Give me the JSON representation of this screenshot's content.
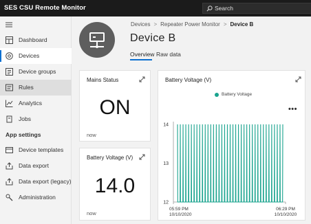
{
  "app": {
    "title": "SES CSU Remote Monitor",
    "search_placeholder": "Search"
  },
  "sidebar": {
    "items": [
      {
        "label": "Dashboard",
        "icon": "dashboard-icon"
      },
      {
        "label": "Devices",
        "icon": "devices-icon"
      },
      {
        "label": "Device groups",
        "icon": "device-groups-icon"
      },
      {
        "label": "Rules",
        "icon": "rules-icon"
      },
      {
        "label": "Analytics",
        "icon": "analytics-icon"
      },
      {
        "label": "Jobs",
        "icon": "jobs-icon"
      }
    ],
    "section_title": "App settings",
    "settings_items": [
      {
        "label": "Device templates",
        "icon": "device-templates-icon"
      },
      {
        "label": "Data export",
        "icon": "data-export-icon"
      },
      {
        "label": "Data export (legacy)",
        "icon": "data-export-legacy-icon"
      },
      {
        "label": "Administration",
        "icon": "administration-icon"
      }
    ],
    "active_item": "Devices",
    "hover_item": "Rules"
  },
  "breadcrumb": {
    "items": [
      "Devices",
      "Repeater Power Monitor",
      "Device B"
    ]
  },
  "device": {
    "name": "Device B",
    "icon": "device-icon"
  },
  "tabs": [
    {
      "label": "Overview",
      "active": true
    },
    {
      "label": "Raw data",
      "active": false
    }
  ],
  "tiles": {
    "mains": {
      "title": "Mains Status",
      "value": "ON",
      "footer": "now"
    },
    "battery_kpi": {
      "title": "Battery Voltage (V)",
      "value": "14.0",
      "footer": "now"
    },
    "battery_chart": {
      "title": "Battery Voltage (V)",
      "more_label": "•••"
    }
  },
  "colors": {
    "accent": "#0a6fd0",
    "series": "#19a38e",
    "topbar": "#1b1b1b"
  },
  "chart_data": {
    "type": "line",
    "title": "Battery Voltage (V)",
    "series": [
      {
        "name": "Battery Voltage",
        "pattern": "oscillation between ~12.0 and ~14.0 V, about 38 cycles"
      }
    ],
    "x_range": [
      "05:59 PM 10/10/2020",
      "06:29 PM 10/10/2020"
    ],
    "xticks": [
      {
        "line1": "05:59 PM",
        "line2": "10/10/2020"
      },
      {
        "line1": "06:29 PM",
        "line2": "10/10/2020"
      }
    ],
    "yticks": [
      {
        "label": "14",
        "value": 14
      },
      {
        "label": "13",
        "value": 13
      },
      {
        "label": "12",
        "value": 12
      }
    ],
    "ylim": [
      12,
      14
    ],
    "cycles": 38,
    "high": 14.0,
    "low": 12.0,
    "legend": "top-center"
  }
}
